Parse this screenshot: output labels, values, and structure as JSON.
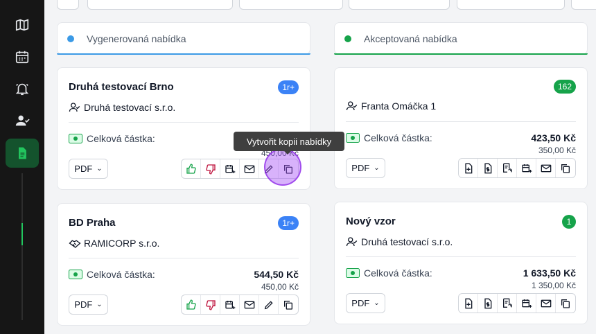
{
  "sidebar": {
    "items": [
      {
        "name": "map-icon"
      },
      {
        "name": "calendar-icon"
      },
      {
        "name": "bell-icon"
      },
      {
        "name": "user-check-icon"
      },
      {
        "name": "document-icon",
        "active": true
      }
    ]
  },
  "columns": [
    {
      "title": "Vygenerovaná nabídka",
      "color": "#3b9ae6"
    },
    {
      "title": "Akceptovaná nabídka",
      "color": "#16a34a"
    }
  ],
  "cards": {
    "c1": {
      "title": "Druhá testovací Brno",
      "badge": "1r+",
      "customer": "Druhá testovací s.r.o.",
      "amount_label": "Celková částka:",
      "total": "",
      "net": "450,00 Kč",
      "pdf": "PDF"
    },
    "c2": {
      "title": "BD Praha",
      "badge": "1r+",
      "customer": "RAMICORP s.r.o.",
      "amount_label": "Celková částka:",
      "total": "544,50 Kč",
      "net": "450,00 Kč",
      "pdf": "PDF"
    },
    "c3": {
      "title": "",
      "badge": "162",
      "customer": "Franta Omáčka 1",
      "amount_label": "Celková částka:",
      "total": "423,50 Kč",
      "net": "350,00 Kč",
      "pdf": "PDF"
    },
    "c4": {
      "title": "Nový vzor",
      "badge": "1",
      "customer": "Druhá testovací s.r.o.",
      "amount_label": "Celková částka:",
      "total": "1 633,50 Kč",
      "net": "1 350,00 Kč",
      "pdf": "PDF"
    }
  },
  "tooltip": {
    "text": "Vytvořit kopii nabídky"
  },
  "colors": {
    "accept": "#16a34a",
    "reject": "#be123c",
    "sidebar": "#161616",
    "active": "#14532d"
  }
}
